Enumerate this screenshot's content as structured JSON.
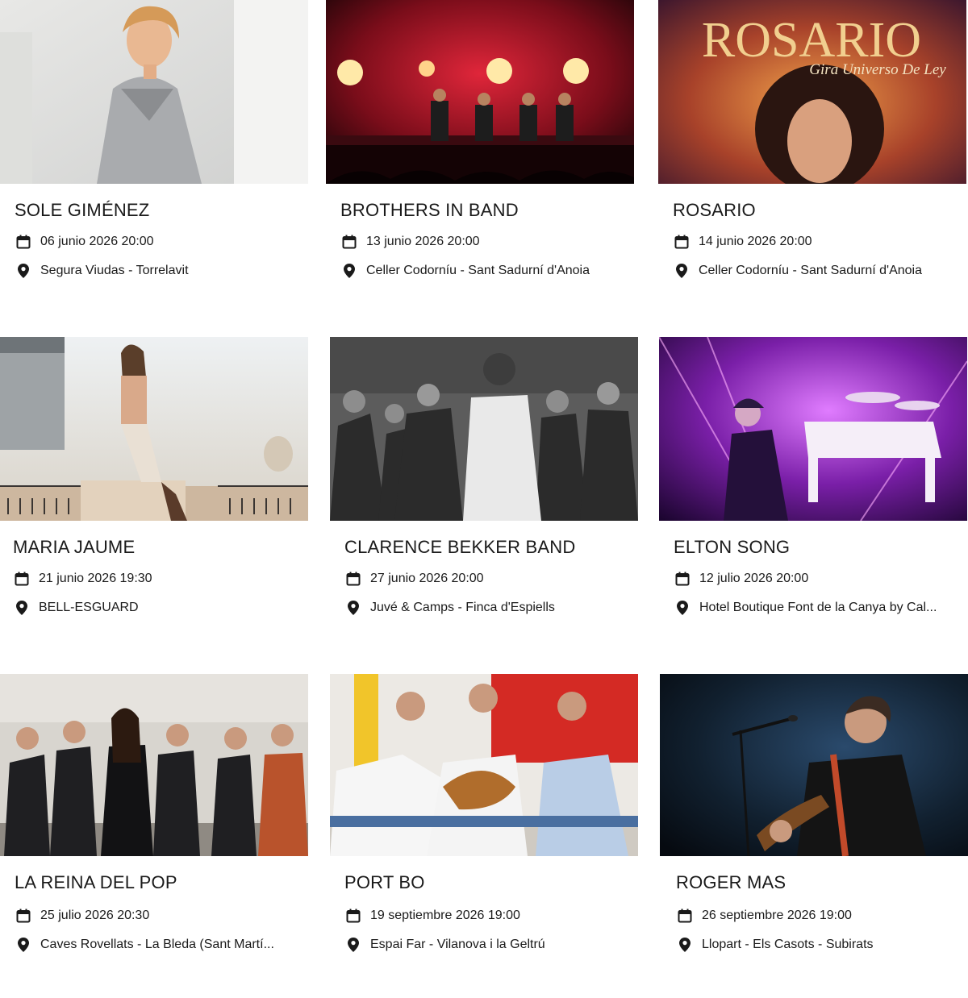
{
  "events": [
    {
      "title": "SOLE GIMÉNEZ",
      "date": "06 junio 2026 20:00",
      "location": "Segura Viudas - Torrelavit",
      "image": "photo-sole-gimenez"
    },
    {
      "title": "BROTHERS IN BAND",
      "date": "13 junio 2026 20:00",
      "location": "Celler Codorníu - Sant Sadurní d'Anoia",
      "image": "photo-brothers-in-band"
    },
    {
      "title": "ROSARIO",
      "date": "14 junio 2026 20:00",
      "location": "Celler Codorníu - Sant Sadurní d'Anoia",
      "image": "poster-rosario",
      "poster_title": "ROSARIO",
      "poster_subtitle": "Gira Universo De Ley"
    },
    {
      "title": "MARIA JAUME",
      "date": "21 junio 2026 19:30",
      "location": "BELL-ESGUARD",
      "image": "photo-maria-jaume"
    },
    {
      "title": "CLARENCE BEKKER BAND",
      "date": "27 junio 2026 20:00",
      "location": "Juvé & Camps - Finca d'Espiells",
      "image": "photo-clarence-bekker-band"
    },
    {
      "title": "ELTON SONG",
      "date": "12 julio 2026 20:00",
      "location": "Hotel Boutique Font de la Canya by Cal...",
      "image": "photo-elton-song"
    },
    {
      "title": "LA REINA DEL POP",
      "date": "25 julio 2026 20:30",
      "location": "Caves Rovellats - La Bleda (Sant Martí...",
      "image": "photo-la-reina-del-pop"
    },
    {
      "title": "PORT BO",
      "date": "19 septiembre 2026 19:00",
      "location": "Espai Far - Vilanova i la Geltrú",
      "image": "photo-port-bo"
    },
    {
      "title": "ROGER MAS",
      "date": "26 septiembre 2026 19:00",
      "location": "Llopart - Els Casots - Subirats",
      "image": "photo-roger-mas"
    }
  ],
  "icons": {
    "date": "calendar-icon",
    "location": "map-pin-icon"
  },
  "colors": {
    "text": "#1a1a1a",
    "background": "#ffffff"
  }
}
